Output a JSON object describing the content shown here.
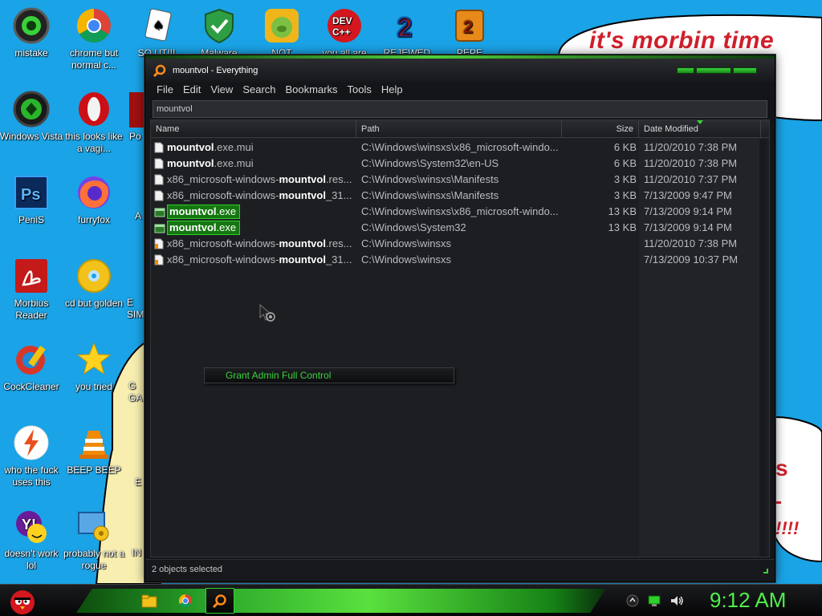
{
  "desktop": {
    "background_text": "it's morbin time",
    "icons": [
      {
        "name": "mistake-icon",
        "label": "mistake"
      },
      {
        "name": "chrome-icon",
        "label": "chrome but normal c..."
      },
      {
        "name": "solitaire-icon",
        "label": "SO UTIII"
      },
      {
        "name": "malware-icon",
        "label": "Malware"
      },
      {
        "name": "bad-piggies-icon",
        "label": "NOT"
      },
      {
        "name": "dev-cpp-icon",
        "label": "you all are"
      },
      {
        "name": "rebewed-icon",
        "label": "REJEWED"
      },
      {
        "name": "pepe-icon",
        "label": "PEPE"
      },
      {
        "name": "windows-vista-icon",
        "label": "Windows Vista"
      },
      {
        "name": "opera-icon",
        "label": "this looks like a vagi..."
      },
      {
        "name": "photoshop-icon",
        "label": "PeniS"
      },
      {
        "name": "firefox-icon",
        "label": "furryfox"
      },
      {
        "name": "adobe-reader-icon",
        "label": "Morbius Reader"
      },
      {
        "name": "cd-icon",
        "label": "cd but golden"
      },
      {
        "name": "ccleaner-icon",
        "label": "CockCleaner"
      },
      {
        "name": "star-icon",
        "label": "you tried"
      },
      {
        "name": "flash-icon",
        "label": "who the fuck uses this"
      },
      {
        "name": "vlc-icon",
        "label": "BEEP BEEP"
      },
      {
        "name": "yahoo-icon",
        "label": "doesn't work lol"
      },
      {
        "name": "rogue-software-icon",
        "label": "probably not a rogue"
      }
    ],
    "partial_labels": [
      "Po",
      "A",
      "E SIM",
      "G GA",
      "E",
      "IN"
    ]
  },
  "window": {
    "title": "mountvol - Everything",
    "menu": [
      "File",
      "Edit",
      "View",
      "Search",
      "Bookmarks",
      "Tools",
      "Help"
    ],
    "search_value": "mountvol",
    "columns": {
      "name": "Name",
      "path": "Path",
      "size": "Size",
      "date": "Date Modified"
    },
    "rows": [
      {
        "pre": "",
        "bold": "mountvol",
        "post": ".exe.mui",
        "path": "C:\\Windows\\winsxs\\x86_microsoft-windo...",
        "size": "6 KB",
        "date": "11/20/2010 7:38 PM",
        "icon": "file-icon",
        "selected": false
      },
      {
        "pre": "",
        "bold": "mountvol",
        "post": ".exe.mui",
        "path": "C:\\Windows\\System32\\en-US",
        "size": "6 KB",
        "date": "11/20/2010 7:38 PM",
        "icon": "file-icon",
        "selected": false
      },
      {
        "pre": "x86_microsoft-windows-",
        "bold": "mountvol",
        "post": ".res...",
        "path": "C:\\Windows\\winsxs\\Manifests",
        "size": "3 KB",
        "date": "11/20/2010 7:37 PM",
        "icon": "file-icon",
        "selected": false
      },
      {
        "pre": "x86_microsoft-windows-",
        "bold": "mountvol",
        "post": "_31...",
        "path": "C:\\Windows\\winsxs\\Manifests",
        "size": "3 KB",
        "date": "7/13/2009 9:47 PM",
        "icon": "file-icon",
        "selected": false
      },
      {
        "pre": "",
        "bold": "mountvol",
        "post": ".exe",
        "path": "C:\\Windows\\winsxs\\x86_microsoft-windo...",
        "size": "13 KB",
        "date": "7/13/2009 9:14 PM",
        "icon": "exe-icon",
        "selected": true
      },
      {
        "pre": "",
        "bold": "mountvol",
        "post": ".exe",
        "path": "C:\\Windows\\System32",
        "size": "13 KB",
        "date": "7/13/2009 9:14 PM",
        "icon": "exe-icon",
        "selected": true
      },
      {
        "pre": "x86_microsoft-windows-",
        "bold": "mountvol",
        "post": ".res...",
        "path": "C:\\Windows\\winsxs",
        "size": "",
        "date": "11/20/2010 7:38 PM",
        "icon": "folder-icon",
        "selected": false
      },
      {
        "pre": "x86_microsoft-windows-",
        "bold": "mountvol",
        "post": "_31...",
        "path": "C:\\Windows\\winsxs",
        "size": "",
        "date": "7/13/2009 10:37 PM",
        "icon": "folder-icon",
        "selected": false
      }
    ],
    "context_menu_item": "Grant Admin Full Control",
    "status": "2 objects selected"
  },
  "taskbar": {
    "clock": "9:12 AM",
    "buttons": [
      "explorer-icon",
      "chrome-icon",
      "everything-search-icon"
    ],
    "tray": [
      "up-arrow-icon",
      "network-icon",
      "volume-icon"
    ]
  },
  "colors": {
    "accent_green": "#3bd03b",
    "desktop_blue": "#1aa3e6",
    "bubble_red": "#d11f2b"
  }
}
